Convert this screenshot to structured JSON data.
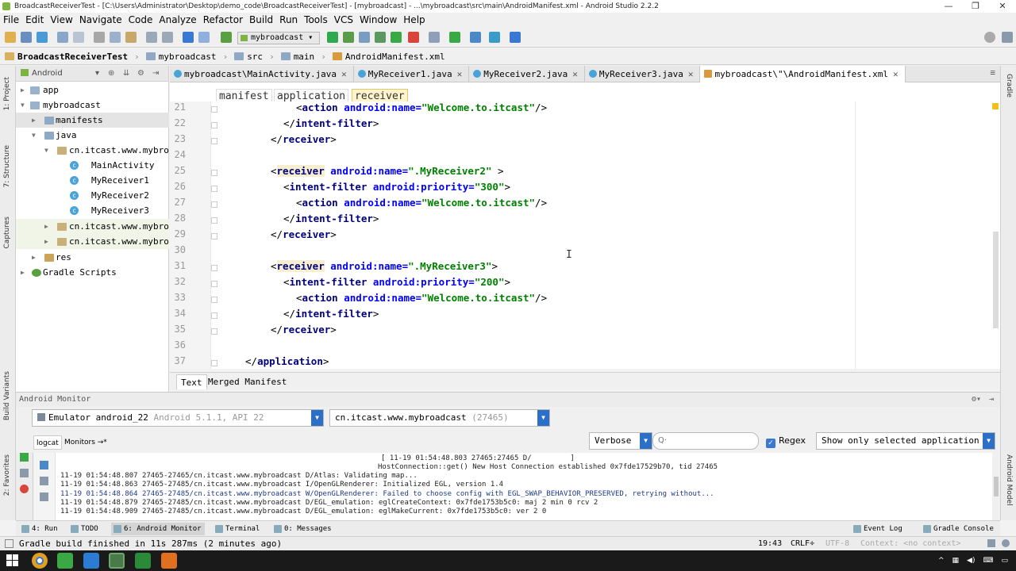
{
  "window": {
    "title": "BroadcastReceiverTest - [C:\\Users\\Administrator\\Desktop\\demo_code\\BroadcastReceiverTest] - [mybroadcast] - ...\\mybroadcast\\src\\main\\AndroidManifest.xml - Android Studio 2.2.2",
    "controls": [
      "—",
      "❐",
      "✕"
    ]
  },
  "menu": [
    "File",
    "Edit",
    "View",
    "Navigate",
    "Code",
    "Analyze",
    "Refactor",
    "Build",
    "Run",
    "Tools",
    "VCS",
    "Window",
    "Help"
  ],
  "toolbar": {
    "run_config": "mybroadcast"
  },
  "breadcrumb": [
    "BroadcastReceiverTest",
    "mybroadcast",
    "src",
    "main",
    "AndroidManifest.xml"
  ],
  "left_strip": {
    "project": "1: Project",
    "structure": "7: Structure",
    "captures": "Captures",
    "build_variants": "Build Variants",
    "favorites": "2: Favorites"
  },
  "right_strip": {
    "gradle": "Gradle",
    "android_model": "Android Model"
  },
  "project": {
    "view_mode": "Android",
    "tree": [
      {
        "label": "app",
        "kind": "module"
      },
      {
        "label": "mybroadcast",
        "kind": "module"
      },
      {
        "label": "manifests",
        "kind": "folder"
      },
      {
        "label": "java",
        "kind": "folder"
      },
      {
        "label": "cn.itcast.www.mybro",
        "kind": "package"
      },
      {
        "label": "MainActivity",
        "kind": "class"
      },
      {
        "label": "MyReceiver1",
        "kind": "class"
      },
      {
        "label": "MyReceiver2",
        "kind": "class"
      },
      {
        "label": "MyReceiver3",
        "kind": "class"
      },
      {
        "label": "cn.itcast.www.mybro",
        "kind": "package"
      },
      {
        "label": "cn.itcast.www.mybro",
        "kind": "package"
      },
      {
        "label": "res",
        "kind": "folder"
      },
      {
        "label": "Gradle Scripts",
        "kind": "gradle"
      }
    ]
  },
  "editor_tabs": [
    {
      "label": "mybroadcast\\MainActivity.java"
    },
    {
      "label": "MyReceiver1.java"
    },
    {
      "label": "MyReceiver2.java"
    },
    {
      "label": "MyReceiver3.java"
    },
    {
      "label": "mybroadcast\\\"\\AndroidManifest.xml"
    }
  ],
  "editor_crumbs": [
    "manifest",
    "application",
    "receiver"
  ],
  "code": {
    "line_numbers": [
      "21",
      "22",
      "23",
      "24",
      "25",
      "26",
      "27",
      "28",
      "29",
      "30",
      "31",
      "32",
      "33",
      "34",
      "35",
      "36",
      "37"
    ],
    "lines": [
      {
        "indent": "        ",
        "open": "<",
        "tag": "action",
        "attr": " android:name=",
        "val": "\"Welcome.to.itcast\"",
        "close": "/>"
      },
      {
        "indent": "    ",
        "open": "</",
        "tag": "intent-filter",
        "attr": "",
        "val": "",
        "close": ">"
      },
      {
        "indent": "",
        "open": "</",
        "tag": "receiver",
        "attr": "",
        "val": "",
        "close": ">"
      },
      {
        "indent": "",
        "open": "",
        "tag": "",
        "attr": "",
        "val": "",
        "close": ""
      },
      {
        "indent": "",
        "open": "<",
        "tag": "receiver",
        "attr": " android:name=",
        "val": "\".MyReceiver2\"",
        "close": " >"
      },
      {
        "indent": "    ",
        "open": "<",
        "tag": "intent-filter",
        "attr": " android:priority=",
        "val": "\"300\"",
        "close": ">"
      },
      {
        "indent": "        ",
        "open": "<",
        "tag": "action",
        "attr": " android:name=",
        "val": "\"Welcome.to.itcast\"",
        "close": "/>"
      },
      {
        "indent": "    ",
        "open": "</",
        "tag": "intent-filter",
        "attr": "",
        "val": "",
        "close": ">"
      },
      {
        "indent": "",
        "open": "</",
        "tag": "receiver",
        "attr": "",
        "val": "",
        "close": ">"
      },
      {
        "indent": "",
        "open": "",
        "tag": "",
        "attr": "",
        "val": "",
        "close": ""
      },
      {
        "indent": "",
        "open": "<",
        "tag": "receiver",
        "attr": " android:name=",
        "val": "\".MyReceiver3\"",
        "close": ">"
      },
      {
        "indent": "    ",
        "open": "<",
        "tag": "intent-filter",
        "attr": " android:priority=",
        "val": "\"200\"",
        "close": ">"
      },
      {
        "indent": "        ",
        "open": "<",
        "tag": "action",
        "attr": " android:name=",
        "val": "\"Welcome.to.itcast\"",
        "close": "/>"
      },
      {
        "indent": "    ",
        "open": "</",
        "tag": "intent-filter",
        "attr": "",
        "val": "",
        "close": ">"
      },
      {
        "indent": "",
        "open": "</",
        "tag": "receiver",
        "attr": "",
        "val": "",
        "close": ">"
      },
      {
        "indent": "",
        "open": "",
        "tag": "",
        "attr": "",
        "val": "",
        "close": ""
      },
      {
        "indent": "",
        "open": "</",
        "tag": "application",
        "attr": "",
        "val": "",
        "close": ">"
      }
    ]
  },
  "editor_bottom_tabs": [
    "Text",
    "Merged Manifest"
  ],
  "monitor": {
    "title": "Android Monitor",
    "device": "Emulator android_22",
    "device_info": "Android 5.1.1, API 22",
    "process": "cn.itcast.www.mybroadcast",
    "pid": "(27465)",
    "tabs": [
      "logcat",
      "Monitors →*"
    ],
    "log_level": "Verbose",
    "search_placeholder": "Q·",
    "regex_label": "Regex",
    "filter": "Show only selected application",
    "log_lines": [
      "[ 11-19 01:54:48.803 27465:27465 D/         ]",
      "HostConnection::get() New Host Connection established 0x7fde17529b70, tid 27465",
      "11-19 01:54:48.807 27465-27465/cn.itcast.www.mybroadcast D/Atlas: Validating map...",
      "11-19 01:54:48.863 27465-27485/cn.itcast.www.mybroadcast I/OpenGLRenderer: Initialized EGL, version 1.4",
      "11-19 01:54:48.864 27465-27485/cn.itcast.www.mybroadcast W/OpenGLRenderer: Failed to choose config with EGL_SWAP_BEHAVIOR_PRESERVED, retrying without...",
      "11-19 01:54:48.879 27465-27485/cn.itcast.www.mybroadcast D/EGL_emulation: eglCreateContext: 0x7fde1753b5c0: maj 2 min 0 rcv 2",
      "11-19 01:54:48.909 27465-27485/cn.itcast.www.mybroadcast D/EGL_emulation: eglMakeCurrent: 0x7fde1753b5c0: ver 2 0"
    ]
  },
  "tool_windows": {
    "left": [
      "4: Run",
      "TODO",
      "6: Android Monitor",
      "Terminal",
      "0: Messages"
    ],
    "right": [
      "Event Log",
      "Gradle Console"
    ]
  },
  "status": {
    "message": "Gradle build finished in 11s 287ms (2 minutes ago)",
    "position": "19:43",
    "line_sep": "CRLF÷",
    "encoding": "UTF-8",
    "context": "Context: <no context>"
  },
  "taskbar": {
    "apps": [
      "chrome-icon",
      "android-studio-icon",
      "vscode-icon",
      "genymotion-icon",
      "terminal-icon",
      "sublime-icon"
    ]
  }
}
